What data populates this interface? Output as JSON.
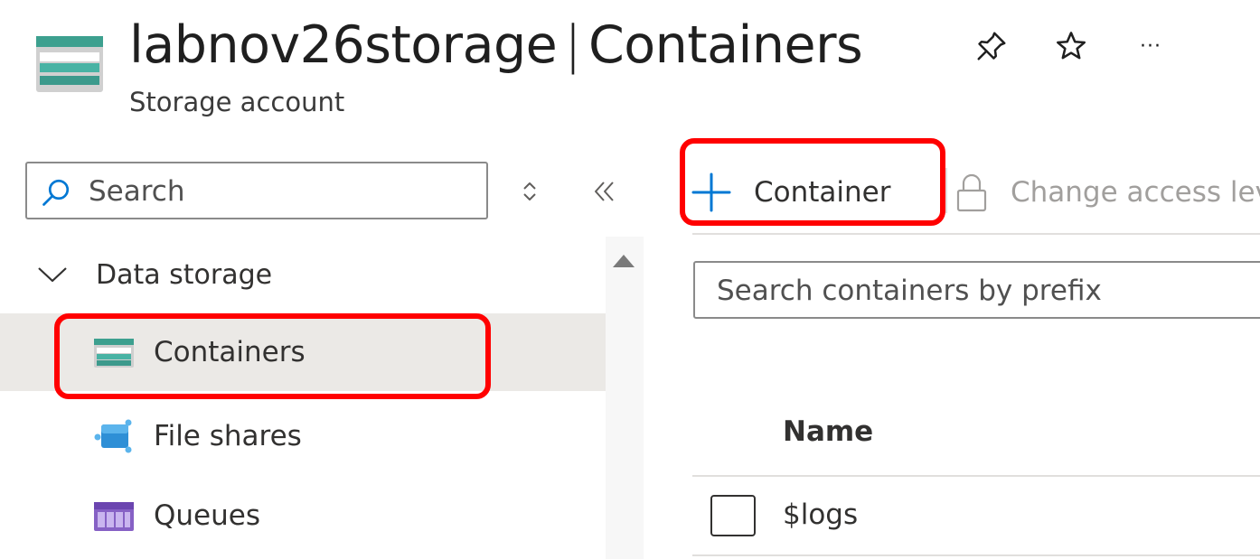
{
  "header": {
    "resource_name": "labnov26storage",
    "separator": "|",
    "page_name": "Containers",
    "resource_type": "Storage account",
    "actions": [
      "pin-icon",
      "star-icon",
      "more-icon"
    ],
    "more_glyph": "···"
  },
  "sidebar": {
    "search": {
      "placeholder": "Search",
      "value": ""
    },
    "group": {
      "label": "Data storage",
      "expanded": true
    },
    "items": [
      {
        "label": "Containers",
        "icon": "containers-icon",
        "active": true
      },
      {
        "label": "File shares",
        "icon": "file-shares-icon",
        "active": false
      },
      {
        "label": "Queues",
        "icon": "queues-icon",
        "active": false
      }
    ]
  },
  "toolbar": {
    "add_container_label": "Container",
    "change_access_label": "Change access lev"
  },
  "main": {
    "prefix_search": {
      "placeholder": "Search containers by prefix",
      "value": ""
    },
    "table": {
      "columns": [
        "Name"
      ],
      "rows": [
        {
          "name": "$logs",
          "selected": false
        }
      ]
    }
  },
  "colors": {
    "accent": "#0078d4",
    "highlight": "#ff0000",
    "active_bg": "#ebe9e6",
    "storage_teal": "#40a598"
  }
}
